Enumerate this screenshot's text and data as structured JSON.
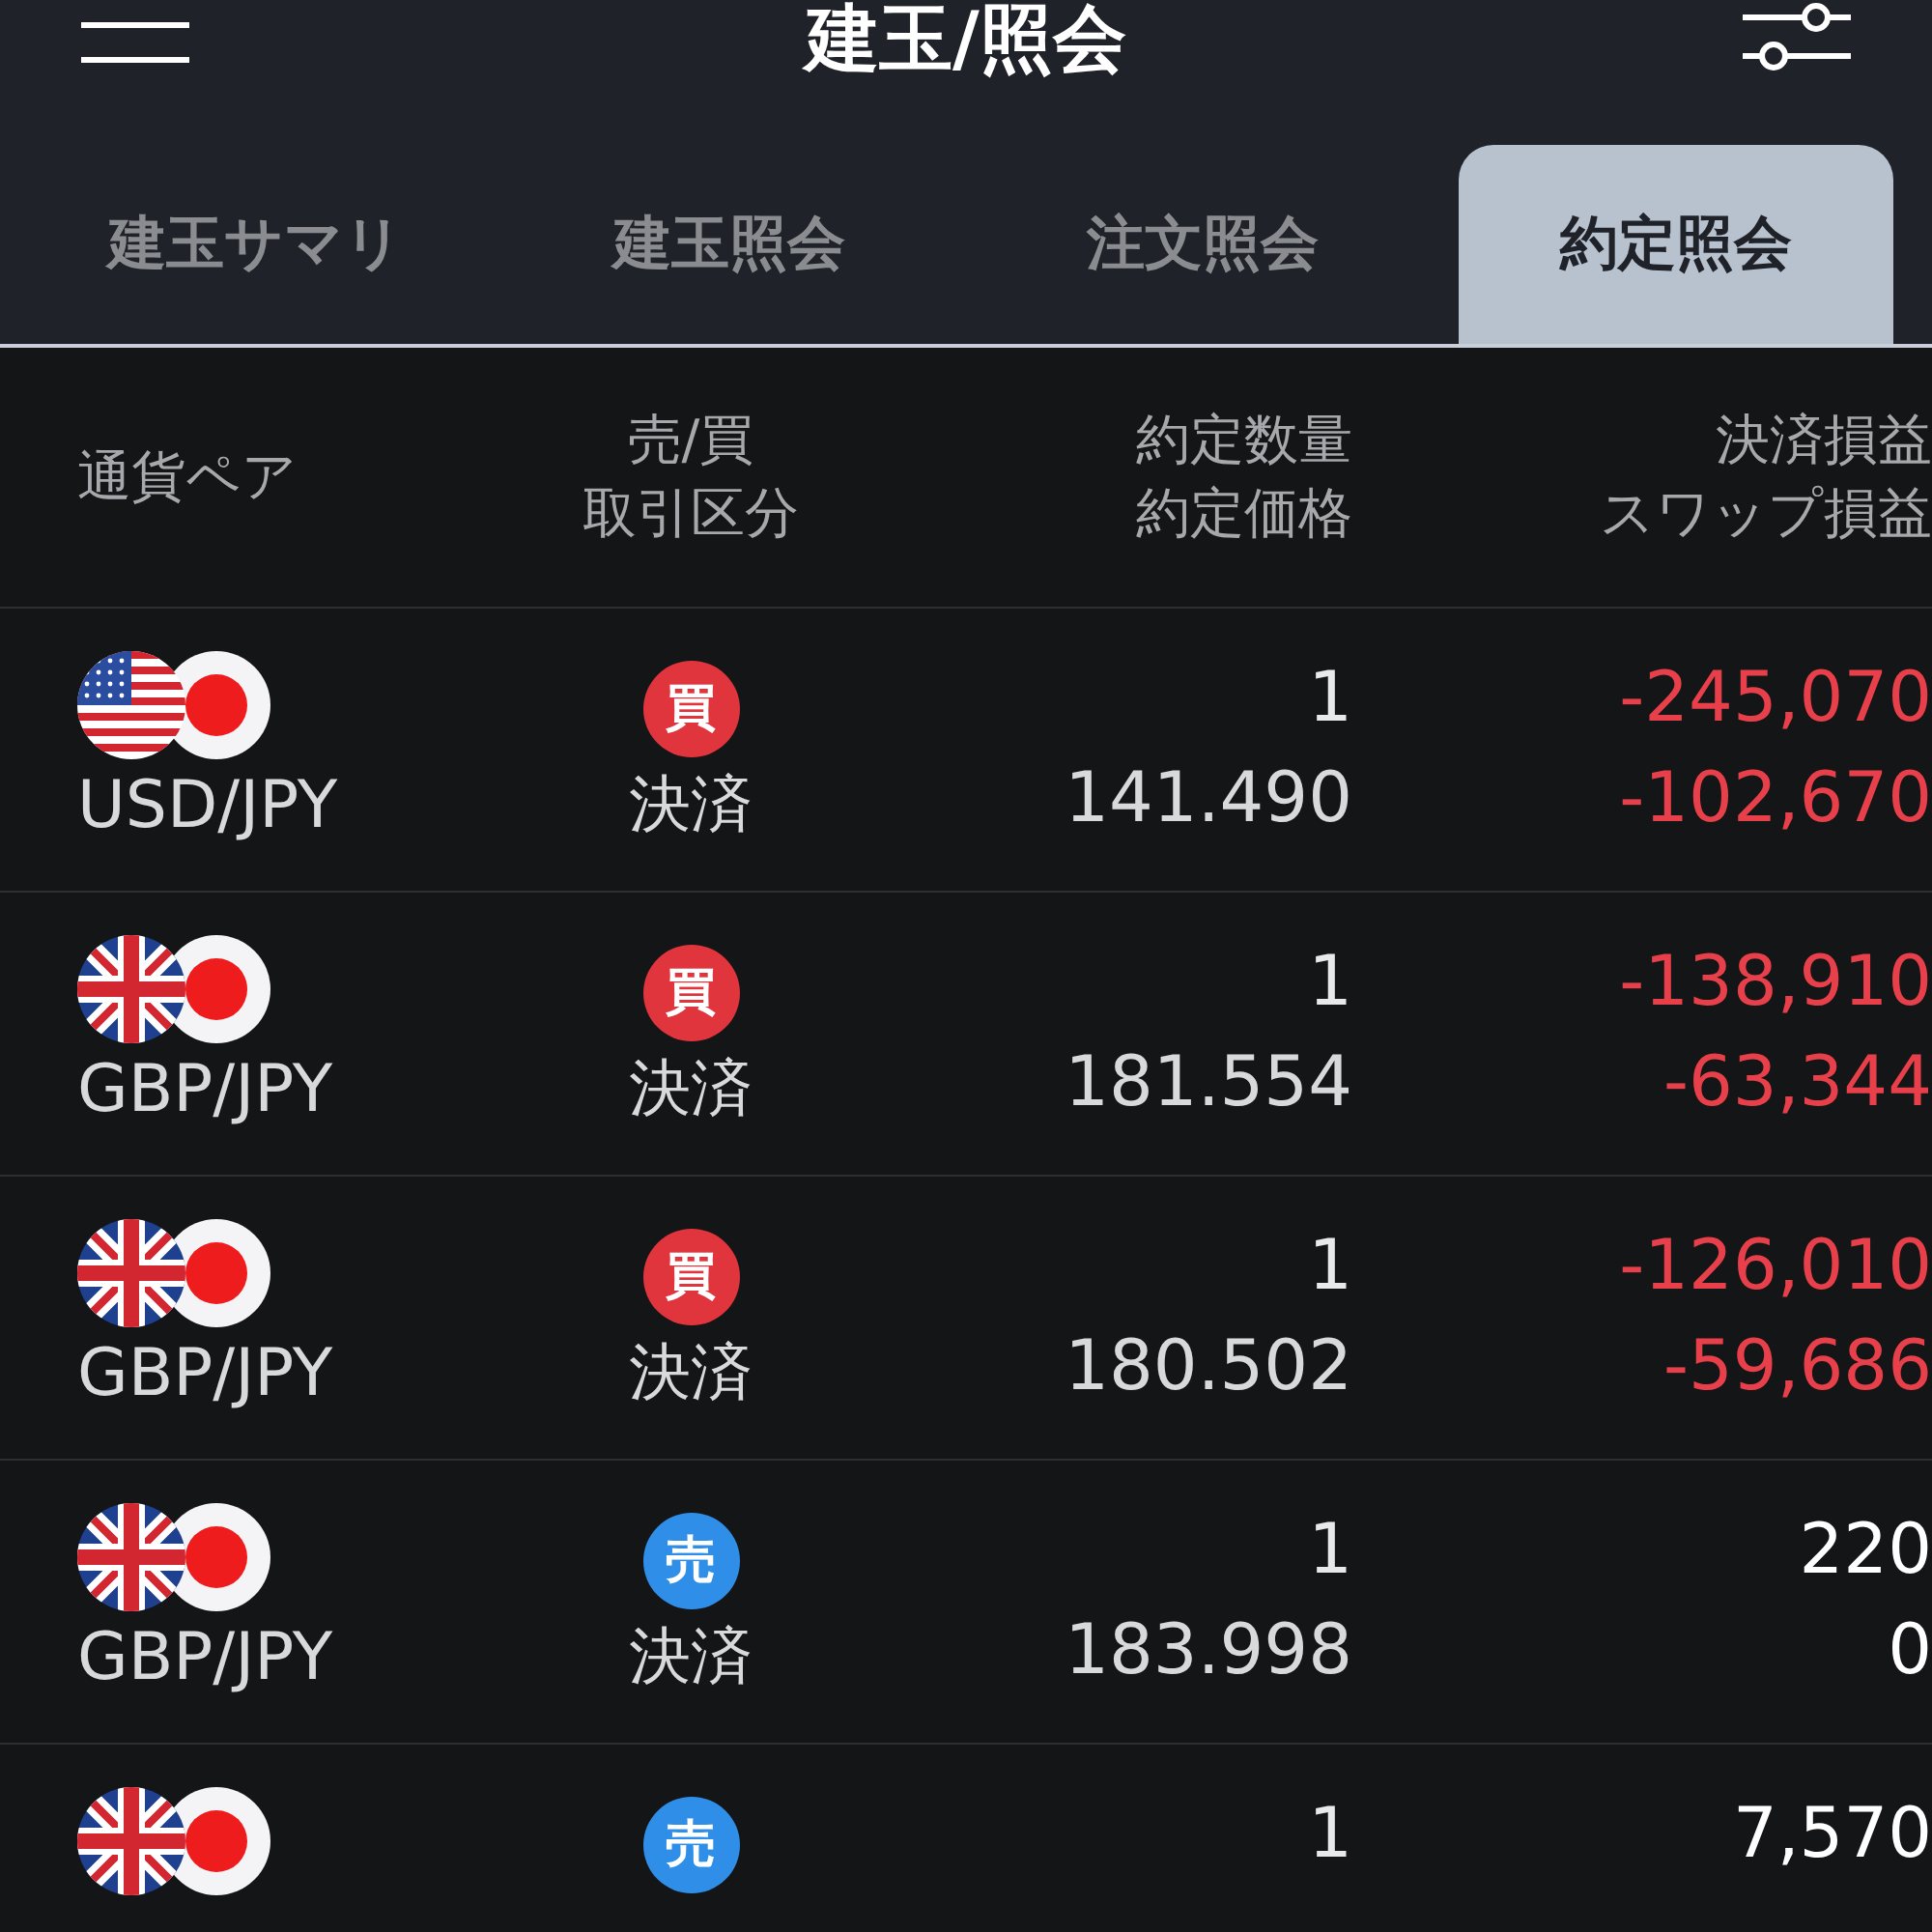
{
  "header": {
    "title": "建玉/照会"
  },
  "tabs": [
    {
      "label": "建玉サマリ",
      "selected": false
    },
    {
      "label": "建玉照会",
      "selected": false
    },
    {
      "label": "注文照会",
      "selected": false
    },
    {
      "label": "約定照会",
      "selected": true
    }
  ],
  "table": {
    "columns": [
      [
        "通貨ペア"
      ],
      [
        "売/買",
        "取引区分"
      ],
      [
        "約定数量",
        "約定価格"
      ],
      [
        "決済損益",
        "スワップ損益"
      ]
    ],
    "rows": [
      {
        "pair": "USD/JPY",
        "kind": "usd",
        "side": {
          "label": "買",
          "kind": "buy"
        },
        "type": "決済",
        "quantity": "1",
        "price": "141.490",
        "pnl": "-245,070",
        "swap": "-102,670",
        "negative": true
      },
      {
        "pair": "GBP/JPY",
        "kind": "gbp",
        "side": {
          "label": "買",
          "kind": "buy"
        },
        "type": "決済",
        "quantity": "1",
        "price": "181.554",
        "pnl": "-138,910",
        "swap": "-63,344",
        "negative": true
      },
      {
        "pair": "GBP/JPY",
        "kind": "gbp",
        "side": {
          "label": "買",
          "kind": "buy"
        },
        "type": "決済",
        "quantity": "1",
        "price": "180.502",
        "pnl": "-126,010",
        "swap": "-59,686",
        "negative": true
      },
      {
        "pair": "GBP/JPY",
        "kind": "gbp",
        "side": {
          "label": "売",
          "kind": "sell"
        },
        "type": "決済",
        "quantity": "1",
        "price": "183.998",
        "pnl": "220",
        "swap": "0",
        "negative": false
      },
      {
        "kind": "gbp",
        "side": {
          "label": "売",
          "kind": "sell"
        },
        "quantity": "1",
        "pnl": "7,570",
        "negative": false
      }
    ]
  }
}
